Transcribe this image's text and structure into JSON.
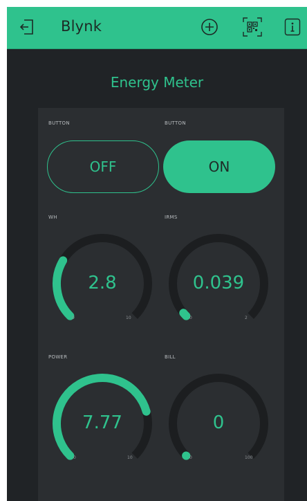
{
  "app": {
    "title": "Blynk"
  },
  "topbar": {
    "icons": [
      "logout-icon",
      "add-icon",
      "qr-code-icon",
      "info-icon"
    ],
    "accent": "#2fc28d"
  },
  "project": {
    "name": "Energy Meter"
  },
  "buttons": [
    {
      "label": "BUTTON",
      "text": "OFF",
      "state": "off"
    },
    {
      "label": "BUTTON",
      "text": "ON",
      "state": "on"
    }
  ],
  "gauges": {
    "wh": {
      "label": "WH",
      "value": "2.8",
      "min": "0",
      "max": "10",
      "level": 0.28
    },
    "irms": {
      "label": "IRMS",
      "value": "0.039",
      "min": "0",
      "max": "2",
      "level": 0.0195
    },
    "power": {
      "label": "POWER",
      "value": "7.77",
      "min": "0",
      "max": "10",
      "level": 0.777
    },
    "bill": {
      "label": "BILL",
      "value": "0",
      "min": "0",
      "max": "100",
      "level": 0
    }
  },
  "colors": {
    "accent": "#2fc28d",
    "background": "#202326",
    "panel": "#2b2e31",
    "track": "#1c1e20"
  }
}
